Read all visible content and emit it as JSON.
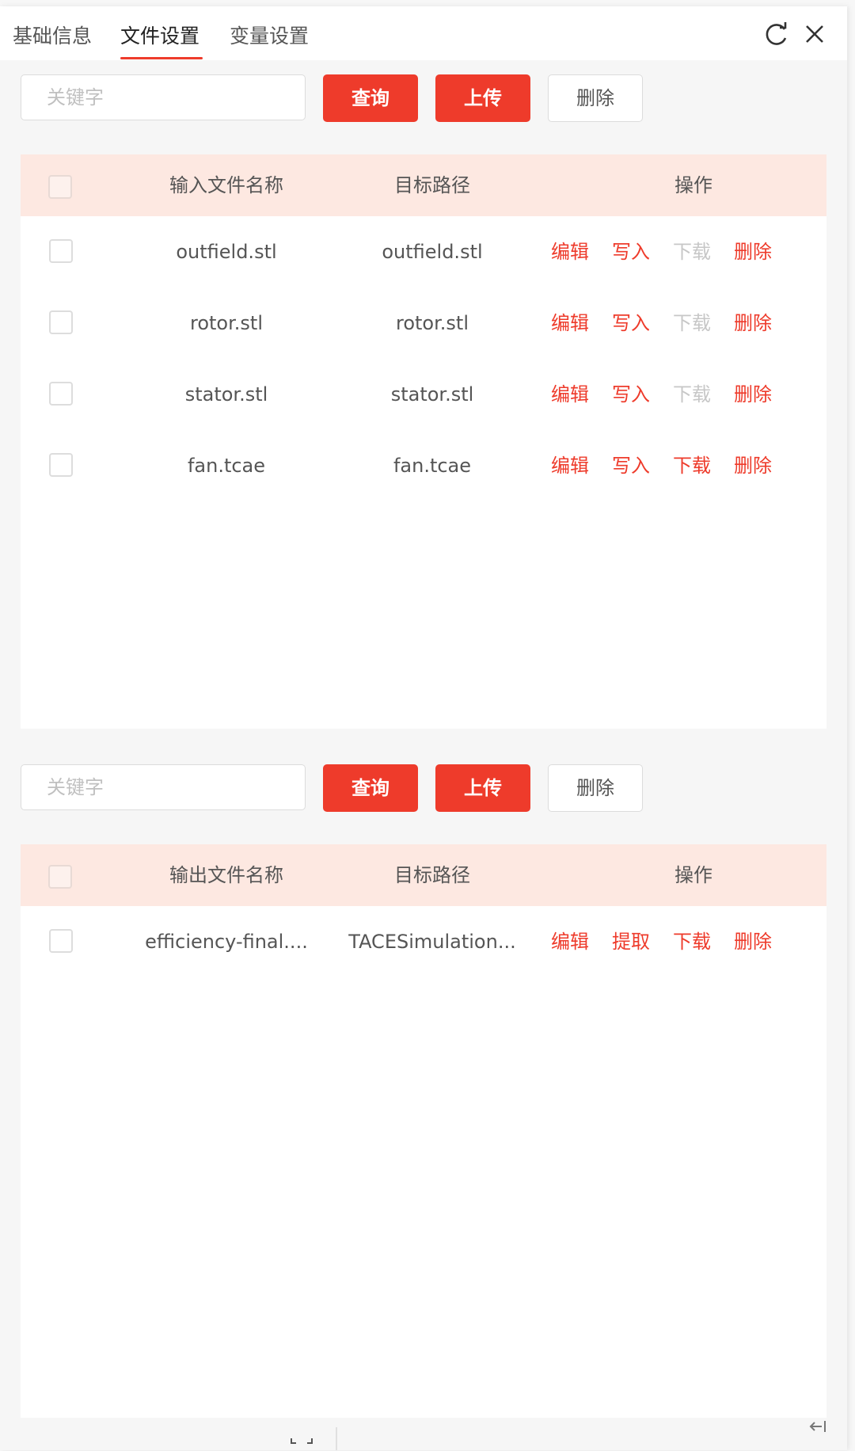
{
  "tabs": [
    {
      "label": "基础信息",
      "active": false
    },
    {
      "label": "文件设置",
      "active": true
    },
    {
      "label": "变量设置",
      "active": false
    }
  ],
  "header_icons": [
    "refresh-icon",
    "close-icon"
  ],
  "input_section": {
    "search_placeholder": "关键字",
    "query_label": "查询",
    "upload_label": "上传",
    "delete_label": "删除",
    "columns": [
      "输入文件名称",
      "目标路径",
      "操作"
    ],
    "rows": [
      {
        "name": "outfield.stl",
        "path": "outfield.stl",
        "actions": [
          "编辑",
          "写入",
          "下载",
          "删除"
        ],
        "download_enabled": false
      },
      {
        "name": "rotor.stl",
        "path": "rotor.stl",
        "actions": [
          "编辑",
          "写入",
          "下载",
          "删除"
        ],
        "download_enabled": false
      },
      {
        "name": "stator.stl",
        "path": "stator.stl",
        "actions": [
          "编辑",
          "写入",
          "下载",
          "删除"
        ],
        "download_enabled": false
      },
      {
        "name": "fan.tcae",
        "path": "fan.tcae",
        "actions": [
          "编辑",
          "写入",
          "下载",
          "删除"
        ],
        "download_enabled": true
      }
    ]
  },
  "output_section": {
    "search_placeholder": "关键字",
    "query_label": "查询",
    "upload_label": "上传",
    "delete_label": "删除",
    "columns": [
      "输出文件名称",
      "目标路径",
      "操作"
    ],
    "rows": [
      {
        "name": "efficiency-final....",
        "path": "TACESimulation...",
        "actions": [
          "编辑",
          "提取",
          "下载",
          "删除"
        ],
        "download_enabled": true
      }
    ]
  },
  "colors": {
    "accent": "#ee3b2b",
    "header_bg": "#fde8e1",
    "disabled": "#c7c7c7"
  }
}
